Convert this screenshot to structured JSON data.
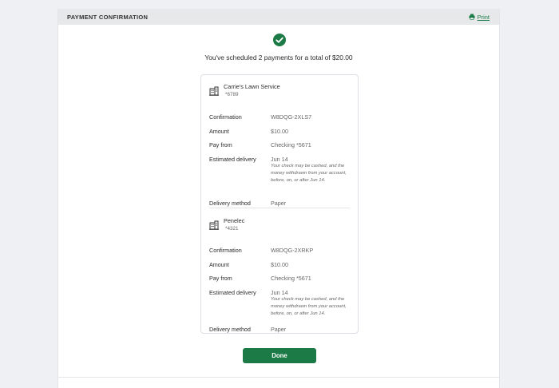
{
  "header": {
    "title": "PAYMENT CONFIRMATION",
    "print_label": "Print"
  },
  "summary": {
    "text": "You've scheduled 2 payments for a total of $20.00"
  },
  "labels": {
    "confirmation": "Confirmation",
    "amount": "Amount",
    "pay_from": "Pay from",
    "estimated_delivery": "Estimated delivery",
    "delivery_method": "Delivery method"
  },
  "payments": [
    {
      "payee": "Carrie's Lawn Service",
      "account": "*6789",
      "confirmation": "W8DQG-2XLS7",
      "amount": "$10.00",
      "pay_from": "Checking *5671",
      "delivery_date": "Jun 14",
      "delivery_note": "Your check may be cashed, and the money withdrawn from your account, before, on, or after Jun 14.",
      "delivery_method": "Paper"
    },
    {
      "payee": "Penelec",
      "account": "*4321",
      "confirmation": "W8DQG-2XRKP",
      "amount": "$10.00",
      "pay_from": "Checking *5671",
      "delivery_date": "Jun 14",
      "delivery_note": "Your check may be cashed, and the money withdrawn from your account, before, on, or after Jun 14.",
      "delivery_method": "Paper"
    }
  ],
  "actions": {
    "done_label": "Done"
  },
  "colors": {
    "brand_green": "#1b7a46",
    "header_bg": "#e7e8ea",
    "page_bg": "#eef0f4"
  }
}
